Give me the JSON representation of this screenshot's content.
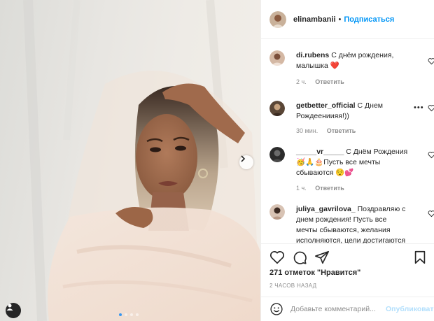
{
  "post": {
    "author": "elinambanii",
    "follow_label": "Подписаться",
    "separator": "•",
    "likes_text": "271 отметок \"Нравится\"",
    "time_ago": "2 ЧАСОВ НАЗАД",
    "carousel": {
      "total": 4,
      "active": 0
    }
  },
  "comments": [
    {
      "username": "di.rubens",
      "text": "С днём рождения, малышка ❤️",
      "time": "2 ч.",
      "reply_label": "Ответить"
    },
    {
      "username": "getbetter_official",
      "text": "С Днем Рождеениияя!))",
      "time": "30 мин.",
      "reply_label": "Ответить"
    },
    {
      "username": "_____vr_____",
      "text": "С Днём Рождения 🥳🙏🎂Пусть все мечты сбываются 😌💕",
      "time": "1 ч.",
      "reply_label": "Ответить"
    },
    {
      "username": "juliya_gavrilova_",
      "text": "Поздравляю с днем рождения! Пусть все мечты сбываются, желания исполняются, цели достигаются",
      "time": "",
      "reply_label": ""
    }
  ],
  "add_comment": {
    "placeholder": "Добавьте комментарий...",
    "publish_label": "Опубликовать"
  },
  "colors": {
    "accent": "#0095f6",
    "publish_disabled": "#b2dffc",
    "muted": "#8e8e8e",
    "like_heart": "#e0245e"
  },
  "icons": {
    "like": "heart-icon",
    "comment": "comment-icon",
    "share": "paper-plane-icon",
    "save": "bookmark-icon",
    "emoji": "smiley-icon",
    "next": "chevron-right-icon",
    "tag": "user-icon"
  }
}
